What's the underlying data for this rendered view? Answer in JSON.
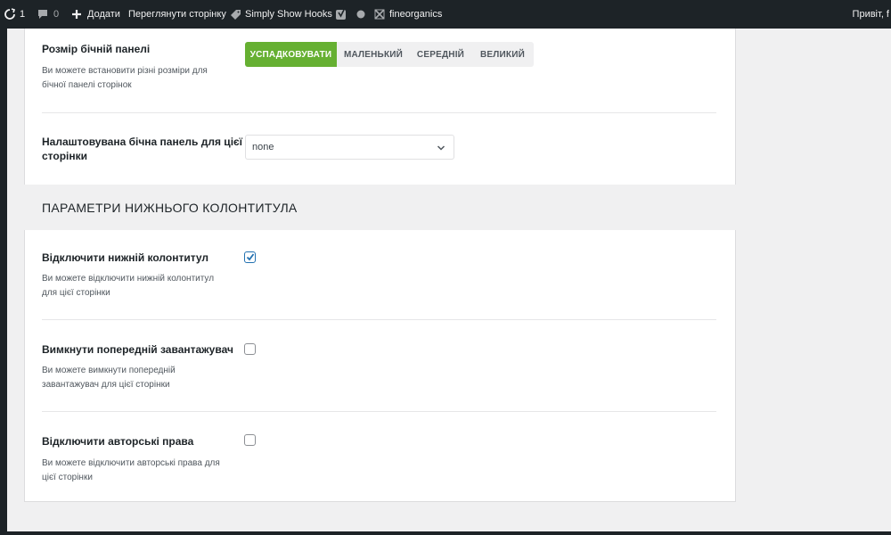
{
  "adminbar": {
    "updates_count": "1",
    "comments_count": "0",
    "add_label": "Додати",
    "view_page_label": "Переглянути сторінку",
    "hooks_label": "Simply Show Hooks",
    "site_name": "fineorganics",
    "greeting": "Привіт, f"
  },
  "sidebar_size": {
    "title": "Розмір бічній панелі",
    "desc_line1": "Ви можете встановити різні розміри для",
    "desc_line2": "бічної панелі сторінок",
    "options": [
      "УСПАДКОВУВАТИ",
      "МАЛЕНЬКИЙ",
      "СЕРЕДНІЙ",
      "ВЕЛИКИЙ"
    ],
    "selected": "УСПАДКОВУВАТИ"
  },
  "custom_sidebar": {
    "title_line1": "Налаштовувана бічна панель для цієї",
    "title_line2": "сторінки",
    "value": "none"
  },
  "footer_section": {
    "heading": "ПАРАМЕТРИ НИЖНЬОГО КОЛОНТИТУЛА"
  },
  "disable_footer": {
    "title": "Відключити нижній колонтитул",
    "desc_line1": "Ви можете відключити нижній колонтитул",
    "desc_line2": "для цієї сторінки",
    "checked": true
  },
  "disable_preloader": {
    "title": "Вимкнути попередній завантажувач",
    "desc_line1": "Ви можете вимкнути попередній",
    "desc_line2": "завантажувач для цієї сторінки",
    "checked": false
  },
  "disable_copyright": {
    "title": "Відключити авторські права",
    "desc_line1": "Ви можете відключити авторські права для",
    "desc_line2": "цієї сторінки",
    "checked": false
  },
  "colors": {
    "accent_green": "#66b032",
    "checkbox_blue": "#2271b1",
    "adminbar_bg": "#1d2327"
  }
}
